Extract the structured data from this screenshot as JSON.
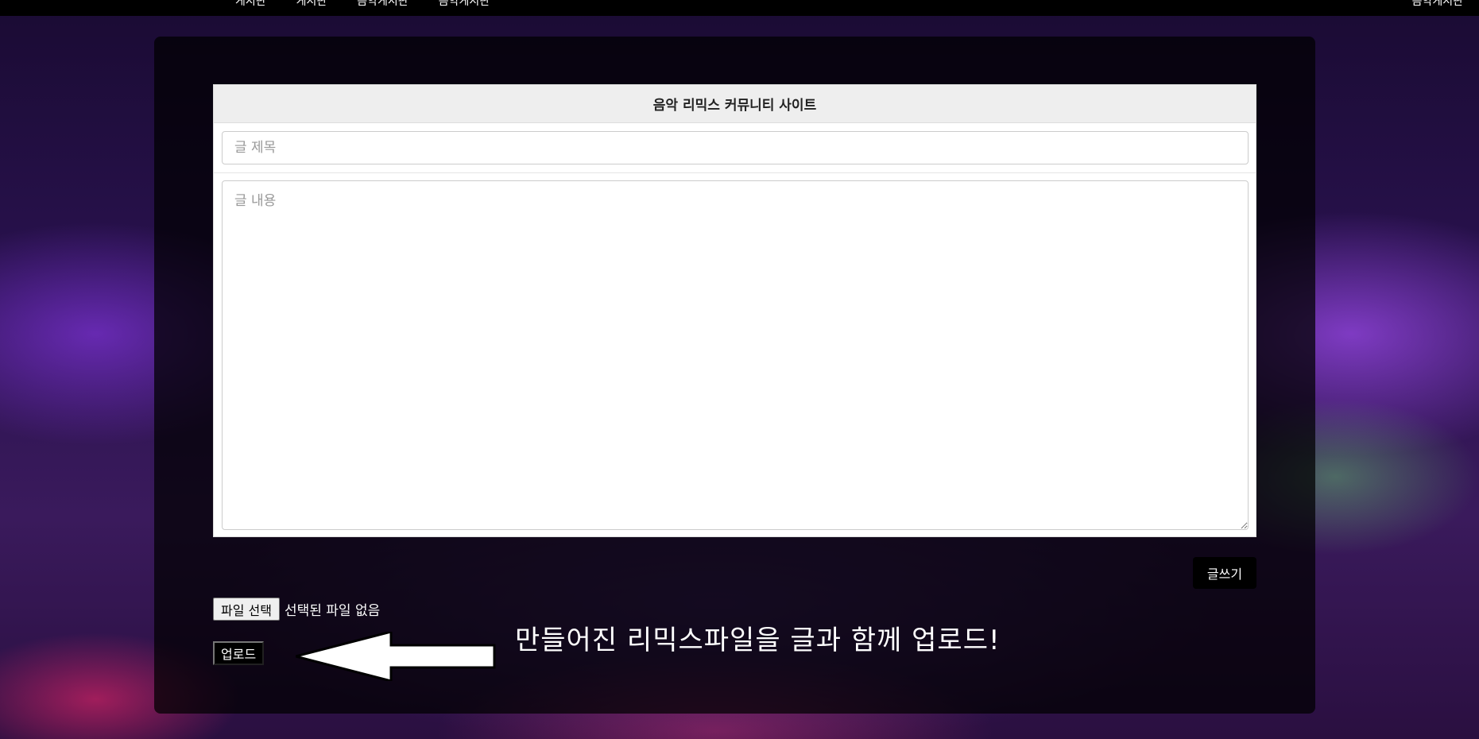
{
  "nav": {
    "items": [
      "게시판",
      "게시판",
      "음악게시판",
      "음악게시판"
    ],
    "right": "음악게시판"
  },
  "form": {
    "header": "음악 리믹스 커뮤니티 사이트",
    "title_placeholder": "글 제목",
    "title_value": "",
    "content_placeholder": "글 내용",
    "content_value": "",
    "write_label": "글쓰기"
  },
  "upload": {
    "choose_label": "파일 선택",
    "status": "선택된 파일 없음",
    "upload_label": "업로드",
    "callout": "만들어진 리믹스파일을 글과 함께 업로드!"
  },
  "icons": {
    "arrow": "left-arrow-icon"
  }
}
